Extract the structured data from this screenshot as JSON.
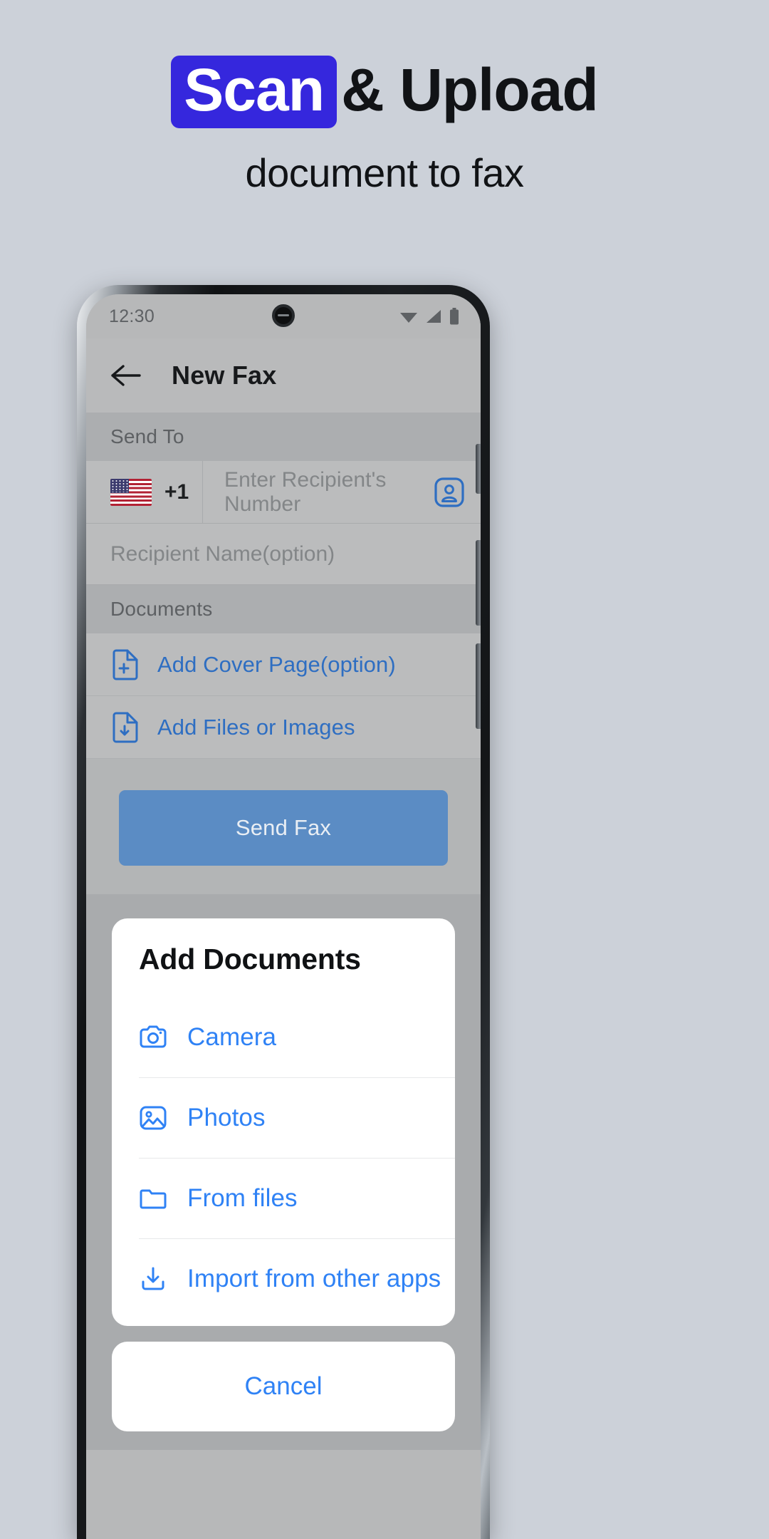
{
  "promo": {
    "badge_text": "Scan",
    "title_rest": "& Upload",
    "subtitle": "document to fax",
    "badge_color": "#3527dd",
    "text_color": "#111316",
    "background": "#ccd1d9"
  },
  "statusbar": {
    "time": "12:30",
    "icons": [
      "wifi-icon",
      "cellular-signal-icon",
      "battery-icon"
    ]
  },
  "appbar": {
    "back_icon": "back-arrow-icon",
    "title": "New Fax"
  },
  "send_to": {
    "section_label": "Send To",
    "country_flag": "us-flag-icon",
    "dial_code": "+1",
    "number_placeholder": "Enter Recipient's Number",
    "number_value": "",
    "contacts_icon": "contact-person-icon",
    "name_placeholder": "Recipient Name(option)",
    "name_value": ""
  },
  "documents": {
    "section_label": "Documents",
    "actions": [
      {
        "icon": "document-add-icon",
        "label": "Add Cover Page(option)"
      },
      {
        "icon": "document-download-icon",
        "label": "Add Files or Images"
      }
    ]
  },
  "send_button": {
    "label": "Send Fax",
    "color": "#5b8cc4"
  },
  "sheet": {
    "title": "Add Documents",
    "accent_color": "#2f82f5",
    "items": [
      {
        "icon": "camera-icon",
        "label": "Camera"
      },
      {
        "icon": "photos-icon",
        "label": "Photos"
      },
      {
        "icon": "folder-icon",
        "label": "From files"
      },
      {
        "icon": "import-download-icon",
        "label": "Import from other apps"
      }
    ],
    "cancel_label": "Cancel"
  }
}
